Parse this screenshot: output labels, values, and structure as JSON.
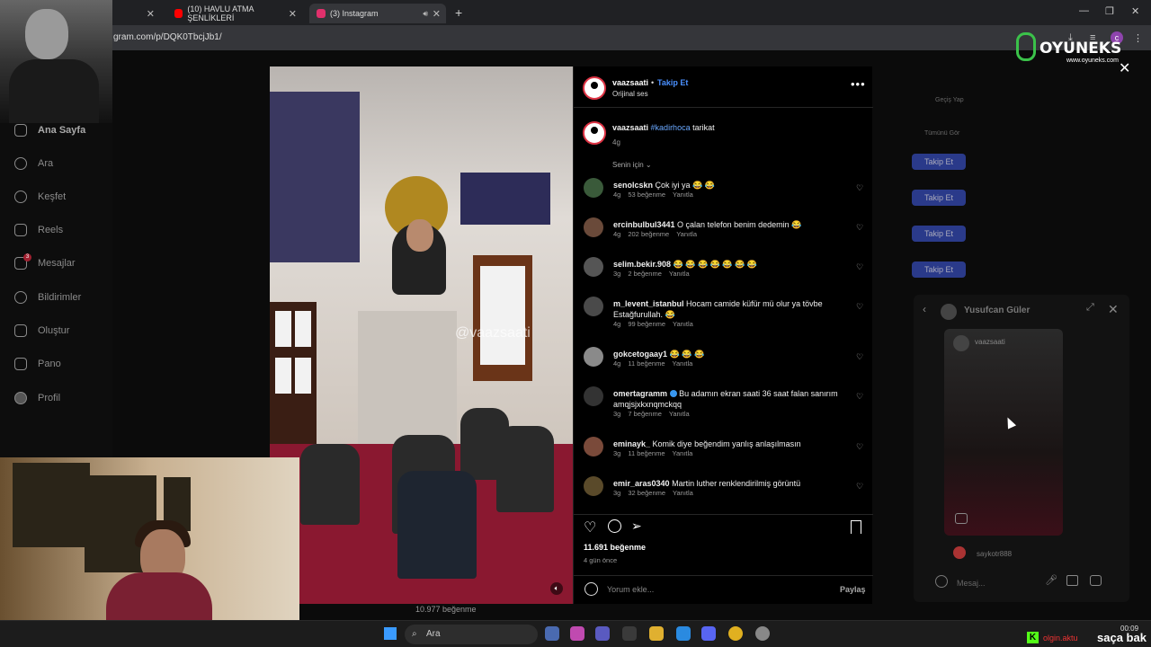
{
  "browser": {
    "tabs": [
      {
        "label": "(10) HAVLU ATMA ŞENLİKLERİ",
        "color": "#ff0000"
      },
      {
        "label": "(3) Instagram",
        "color": "#e1306c"
      }
    ],
    "url": "gram.com/p/DQK0TbcjJb1/"
  },
  "nav": {
    "items": [
      "Ana Sayfa",
      "Ara",
      "Keşfet",
      "Reels",
      "Mesajlar",
      "Bildirimler",
      "Oluştur",
      "Pano",
      "Profil"
    ],
    "messages_badge": "3"
  },
  "suggestions": {
    "switch": "Geçiş Yap",
    "see_all": "Tümünü Gör",
    "follow_label": "Takip Et"
  },
  "post": {
    "username": "vaazsaati",
    "follow": "Takip Et",
    "audio": "Orijinal ses",
    "caption_user": "vaazsaati",
    "caption_tag": "#kadirhoca",
    "caption_text": "tarikat",
    "caption_time": "4g",
    "sort_label": "Senin için",
    "watermark": "@vaazsaati",
    "likes": "11.691 beğenme",
    "time_ago": "4 gün önce",
    "comment_placeholder": "Yorum ekle...",
    "share": "Paylaş",
    "reply_label": "Yanıtla"
  },
  "comments": [
    {
      "user": "senolcskn",
      "text": "Çok iyi ya 😂 😂",
      "time": "4g",
      "likes": "53 beğenme",
      "avatar": "#3a5a3a"
    },
    {
      "user": "ercinbulbul3441",
      "text": "O çalan telefon benim dedemin 😂",
      "time": "4g",
      "likes": "202 beğenme",
      "avatar": "#6a4a3a"
    },
    {
      "user": "selim.bekir.908",
      "text": "😂 😂 😂 😂 😂 😂 😂",
      "time": "3g",
      "likes": "2 beğenme",
      "avatar": "#555555"
    },
    {
      "user": "m_levent_istanbul",
      "text": "Hocam camide küfür mü olur ya tövbe Estağfurullah. 😂",
      "time": "4g",
      "likes": "99 beğenme",
      "avatar": "#4a4a4a"
    },
    {
      "user": "gokcetogaay1",
      "text": "😂 😂 😂",
      "time": "4g",
      "likes": "11 beğenme",
      "avatar": "#8a8a8a"
    },
    {
      "user": "omertagramm",
      "text": "Bu adamın ekran saati 36 saat falan sanırım amqjsjxkxnqmckqq",
      "time": "3g",
      "likes": "7 beğenme",
      "avatar": "#333333",
      "verified": true
    },
    {
      "user": "eminayk_",
      "text": "Komik diye beğendim yanlış anlaşılmasın",
      "time": "3g",
      "likes": "11 beğenme",
      "avatar": "#7a4a3a"
    },
    {
      "user": "emir_aras0340",
      "text": "Martin luther renklendirilmiş görüntü",
      "time": "3g",
      "likes": "32 beğenme",
      "avatar": "#5a4a2a"
    }
  ],
  "chat": {
    "name": "Yusufcan Güler",
    "card_user": "vaazsaati",
    "sender": "saykotr888",
    "input_placeholder": "Mesaj..."
  },
  "background": {
    "behind_likes": "10.977 beğenme"
  },
  "overlay": {
    "logo_name": "OYUNEKS",
    "logo_site": "www.oyuneks.com",
    "kick_icon": "K",
    "kick_name": "olgin.aktu",
    "corner_text": "saça bak"
  },
  "taskbar": {
    "search": "Ara",
    "time": "00:09"
  },
  "colors": {
    "accent": "#4a90ff",
    "follow_button": "#2a3a8a",
    "carpet": "#8a1830"
  }
}
